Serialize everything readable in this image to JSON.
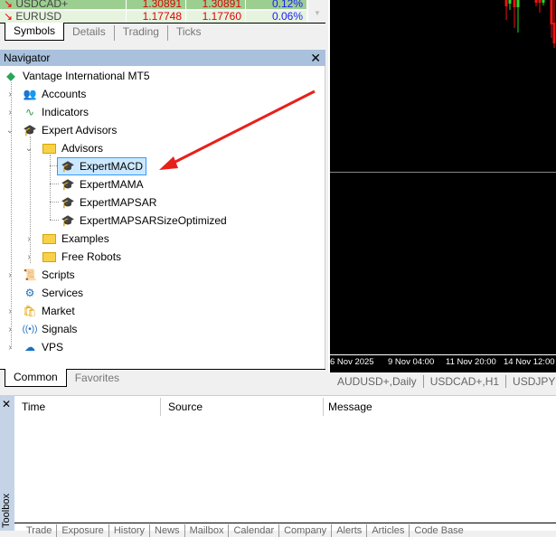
{
  "market_watch": {
    "rows": [
      {
        "symbol": "USDCAD+",
        "bid": "1.30891",
        "ask": "1.30891",
        "change": "0.12%"
      },
      {
        "symbol": "EURUSD",
        "bid": "1.17748",
        "ask": "1.17760",
        "change": "0.06%"
      }
    ],
    "tabs": [
      "Symbols",
      "Details",
      "Trading",
      "Ticks"
    ]
  },
  "navigator": {
    "title": "Navigator",
    "root": "Vantage International MT5",
    "items": [
      "Accounts",
      "Indicators",
      "Expert Advisors",
      "Advisors",
      "ExpertMACD",
      "ExpertMAMA",
      "ExpertMAPSAR",
      "ExpertMAPSARSizeOptimized",
      "Examples",
      "Free Robots",
      "Scripts",
      "Services",
      "Market",
      "Signals",
      "VPS"
    ],
    "selected": "ExpertMACD",
    "tabs": [
      "Common",
      "Favorites"
    ]
  },
  "chart": {
    "time_labels": [
      "6 Nov 2025",
      "9 Nov 04:00",
      "11 Nov 20:00",
      "14 Nov 12:00"
    ],
    "tabs": [
      "AUDUSD+,Daily",
      "USDCAD+,H1",
      "USDJPY"
    ],
    "bull_color": "#22dd22",
    "bear_color": "#ee1111"
  },
  "toolbox": {
    "label": "Toolbox",
    "columns": [
      "Time",
      "Source",
      "Message"
    ],
    "tabs": [
      "Trade",
      "Exposure",
      "History",
      "News",
      "Mailbox",
      "Calendar",
      "Company",
      "Alerts",
      "Articles",
      "Code Base"
    ]
  }
}
